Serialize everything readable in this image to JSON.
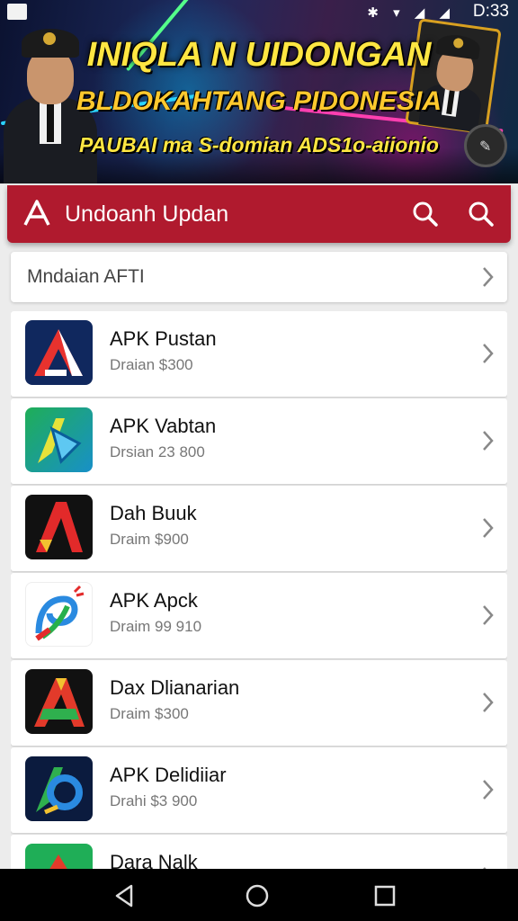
{
  "status_bar": {
    "time": "D:33",
    "icons": "✱ ▾ ◢ ◢"
  },
  "banner": {
    "headline_line1": "INIQLA N UIDONGAN",
    "headline_line2": "BLDOKAHTANG PIDONESIA",
    "headline_line3": "PAUBAI ma  S-domian ADS1o-aiionio"
  },
  "app_bar": {
    "logo_letter": "A",
    "title": "Undoanh Updan"
  },
  "search": {
    "placeholder": "Mndaian AFTI"
  },
  "apps": [
    {
      "name": "APK Pustan",
      "subtitle": "Draian $300",
      "icon": "navy-red-a-icon"
    },
    {
      "name": "APK Vabtan",
      "subtitle": "Drsian 23 800",
      "icon": "green-blue-a-icon"
    },
    {
      "name": "Dah Buuk",
      "subtitle": "Draim $900",
      "icon": "black-red-a-icon"
    },
    {
      "name": "APK  Apck",
      "subtitle": "Draim 99 910",
      "icon": "white-swirl-a-icon"
    },
    {
      "name": "Dax Dlianarian",
      "subtitle": "Draim $300",
      "icon": "black-gold-a-icon"
    },
    {
      "name": "APK Delidiiar",
      "subtitle": "Drahi $3 900",
      "icon": "dark-blue-a-icon"
    },
    {
      "name": "Dara Nalk",
      "subtitle": "",
      "icon": "green-red-a-icon"
    }
  ],
  "colors": {
    "app_bar": "#b01a2e",
    "banner_text": "#ffe642"
  }
}
